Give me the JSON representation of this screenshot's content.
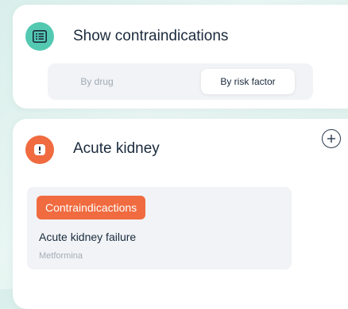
{
  "contraindications_panel": {
    "title": "Show contraindications",
    "icon": "list-icon",
    "tabs": [
      {
        "label": "By drug",
        "selected": false
      },
      {
        "label": "By risk factor",
        "selected": true
      }
    ]
  },
  "risk_card": {
    "title": "Acute kidney",
    "icon": "exclamation-icon",
    "add_icon": "plus-circle-icon",
    "item": {
      "badge": "Contraindicactions",
      "title": "Acute kidney failure",
      "drug": "Metformina"
    }
  },
  "colors": {
    "accent_green": "#54c9b2",
    "accent_orange": "#f06b3f",
    "text_dark": "#1a2a3c"
  }
}
